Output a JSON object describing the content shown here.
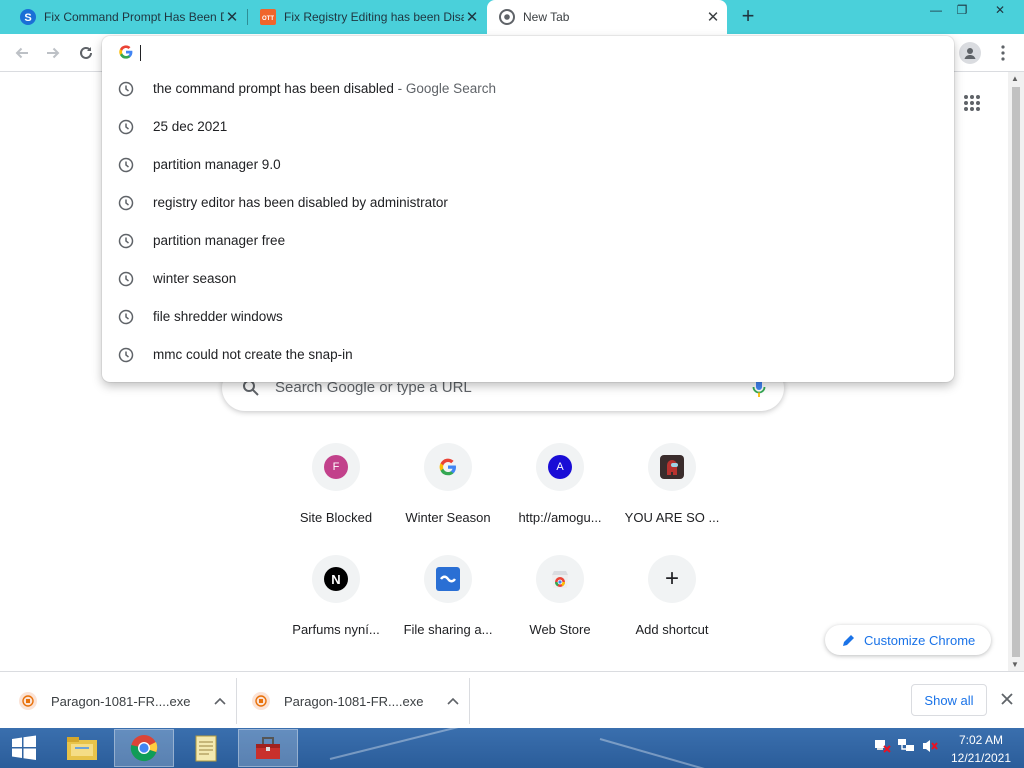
{
  "colors": {
    "tabstrip": "#4ad0da",
    "accent": "#1a73e8",
    "taskbar": "#2b5d9a"
  },
  "tabs": [
    {
      "title": "Fix Command Prompt Has Been Disabled",
      "icon": "s-letter-icon"
    },
    {
      "title": "Fix Registry Editing has been Disabled",
      "icon": "ott-icon"
    },
    {
      "title": "New Tab",
      "icon": "chrome-icon"
    }
  ],
  "new_tab_glyph": "+",
  "close_glyph": "✕",
  "window": {
    "minimize": "—",
    "maximize": "❐",
    "close": "✕"
  },
  "omnibox": {
    "value": "",
    "suggestions": [
      {
        "text": "the command prompt has been disabled",
        "suffix": " - Google Search"
      },
      {
        "text": "25 dec 2021",
        "suffix": ""
      },
      {
        "text": "partition manager 9.0",
        "suffix": ""
      },
      {
        "text": "registry editor has been disabled by administrator",
        "suffix": ""
      },
      {
        "text": "partition manager free",
        "suffix": ""
      },
      {
        "text": "winter season",
        "suffix": ""
      },
      {
        "text": "file shredder windows",
        "suffix": ""
      },
      {
        "text": "mmc could not create the snap-in",
        "suffix": ""
      }
    ]
  },
  "search": {
    "placeholder": "Search Google or type a URL"
  },
  "shortcuts": [
    {
      "label": "Site Blocked",
      "icon": "f-letter-icon",
      "letter": "F"
    },
    {
      "label": "Winter Season",
      "icon": "google-g-icon",
      "letter": "G"
    },
    {
      "label": "http://amogu...",
      "icon": "a-letter-icon",
      "letter": "A"
    },
    {
      "label": "YOU ARE SO ...",
      "icon": "among-us-icon",
      "letter": ""
    },
    {
      "label": "Parfums nyní...",
      "icon": "n-letter-icon",
      "letter": "N"
    },
    {
      "label": "File sharing a...",
      "icon": "file-sharing-icon",
      "letter": ""
    },
    {
      "label": "Web Store",
      "icon": "web-store-icon",
      "letter": ""
    },
    {
      "label": "Add shortcut",
      "icon": "plus-icon",
      "letter": "+"
    }
  ],
  "customize_label": "Customize Chrome",
  "downloads": {
    "items": [
      {
        "name": "Paragon-1081-FR....exe"
      },
      {
        "name": "Paragon-1081-FR....exe"
      }
    ],
    "show_all": "Show all"
  },
  "taskbar": {
    "time": "7:02 AM",
    "date": "12/21/2021",
    "apps": [
      "file-explorer-icon",
      "chrome-icon",
      "notepad-icon",
      "toolbox-icon"
    ]
  }
}
